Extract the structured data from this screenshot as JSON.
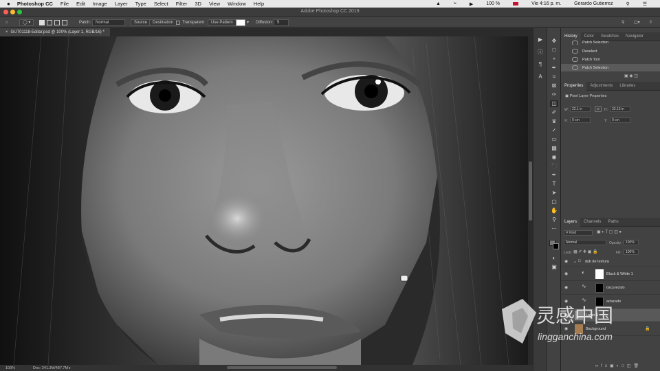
{
  "menubar": {
    "apple": "",
    "app": "Photoshop CC",
    "items": [
      "File",
      "Edit",
      "Image",
      "Layer",
      "Type",
      "Select",
      "Filter",
      "3D",
      "View",
      "Window",
      "Help"
    ],
    "status": {
      "battery": "100 %",
      "flag": "",
      "clock": "Vie 4:16 p. m.",
      "user": "Gerardo Gutierrez"
    }
  },
  "window": {
    "title": "Adobe Photoshop CC 2019"
  },
  "options": {
    "patch_label": "Patch:",
    "patch_value": "Normal",
    "source": "Source",
    "destination": "Destination",
    "transparent": "Transparent",
    "use_pattern": "Use Pattern",
    "diffusion_label": "Diffusion:",
    "diffusion_value": "5"
  },
  "document": {
    "tab": "GUT01118-Editar.psd @ 100% (Layer 1, RGB/16) *"
  },
  "status": {
    "zoom": "100%",
    "doc": "Doc: 241.3M/487.7M"
  },
  "history": {
    "tabs": [
      "History",
      "Color",
      "Swatches",
      "Navigator"
    ],
    "items": [
      "Patch Selection",
      "Deselect",
      "Patch Tool",
      "Patch Selection"
    ]
  },
  "properties": {
    "tabs": [
      "Properties",
      "Adjustments",
      "Libraries"
    ],
    "title": "Pixel Layer Properties",
    "w_label": "W:",
    "w_value": "22.1 in",
    "h_label": "H:",
    "h_value": "33.13 in",
    "x_label": "X:",
    "x_value": "0 cm",
    "y_label": "Y:",
    "y_value": "0 cm"
  },
  "layers": {
    "tabs": [
      "Layers",
      "Channels",
      "Paths"
    ],
    "kind": "Kind",
    "blend": "Normal",
    "opacity_label": "Opacity:",
    "opacity": "100%",
    "lock_label": "Lock:",
    "fill_label": "Fill:",
    "fill": "100%",
    "rows": [
      {
        "name": "dyb de textura",
        "type": "group"
      },
      {
        "name": "Black & White 1",
        "type": "adjustment"
      },
      {
        "name": "oscurecido",
        "type": "curves"
      },
      {
        "name": "aclarado",
        "type": "curves"
      },
      {
        "name": "Layer 1",
        "type": "pixel"
      },
      {
        "name": "Background",
        "type": "pixel"
      }
    ]
  },
  "watermark": {
    "cn": "灵感中国",
    "url": "lingganchina.com"
  }
}
